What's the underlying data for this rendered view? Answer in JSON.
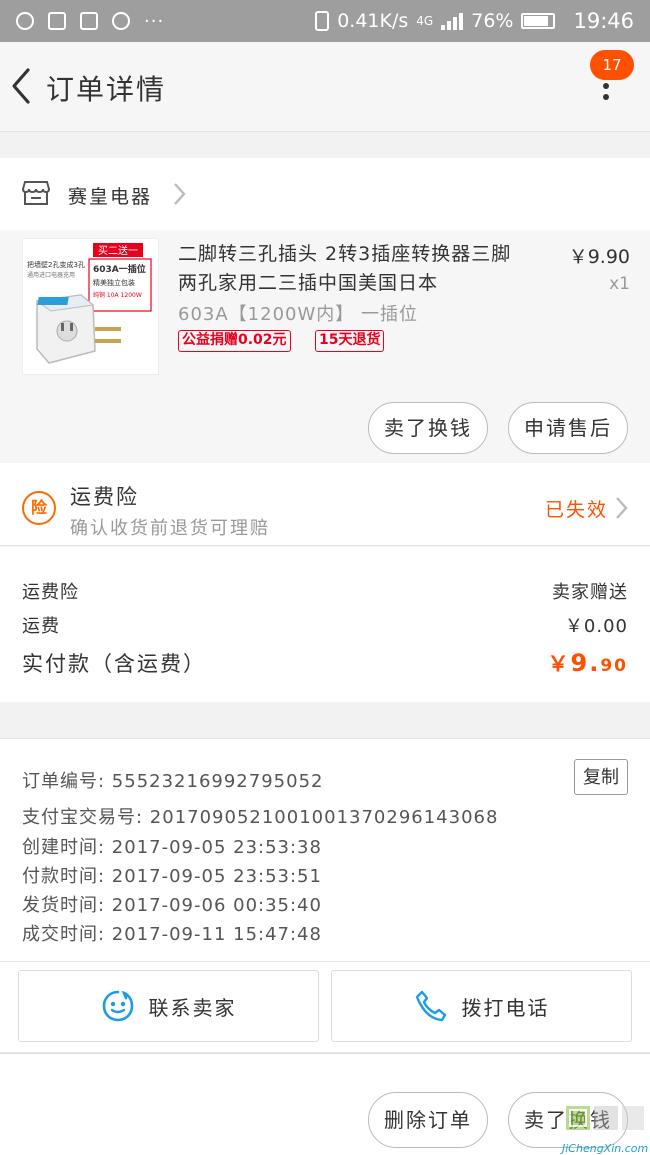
{
  "status_bar": {
    "network_speed": "0.41K/s",
    "network_type": "4G",
    "battery": "76%",
    "time": "19:46",
    "more_glyph": "···"
  },
  "header": {
    "title": "订单详情",
    "badge_count": "17"
  },
  "shop": {
    "name": "赛皇电器"
  },
  "product": {
    "name": "二脚转三孔插头 2转3插座转换器三脚两孔家用二三插中国美国日本",
    "sku": "603A【1200W内】 一插位",
    "tags": [
      "公益捐赠0.02元",
      "15天退货"
    ],
    "price": "￥9.90",
    "quantity": "x1",
    "thumb_text": {
      "banner": "买二送一",
      "line1": "把墙壁2孔变成3孔",
      "line2": "通用进口电器充用",
      "model": "603A一插位",
      "pack": "精美独立包装",
      "spec": "纯铜 10A 1200W"
    },
    "buttons": {
      "sell": "卖了换钱",
      "after_sale": "申请售后"
    }
  },
  "insurance": {
    "icon_char": "险",
    "title": "运费险",
    "subtitle": "确认收货前退货可理赔",
    "status": "已失效"
  },
  "fees": {
    "rows": [
      {
        "label": "运费险",
        "value": "卖家赠送"
      },
      {
        "label": "运费",
        "value": "￥0.00"
      }
    ],
    "total_label": "实付款（含运费）",
    "total_currency": "￥",
    "total_int": "9.",
    "total_dec": "90"
  },
  "order_info": {
    "copy_label": "复制",
    "rows": [
      "订单编号: 55523216992795052",
      "支付宝交易号: 2017090521001001370296143068",
      "创建时间: 2017-09-05 23:53:38",
      "付款时间: 2017-09-05 23:53:51",
      "发货时间: 2017-09-06 00:35:40",
      "成交时间: 2017-09-11 15:47:48"
    ]
  },
  "contact": {
    "seller": "联系卖家",
    "call": "拨打电话"
  },
  "bottom": {
    "delete": "删除订单",
    "sell": "卖了换钱"
  },
  "watermark": {
    "text": "JiChengXin.com"
  },
  "colors": {
    "accent": "#ff5000",
    "tag_red": "#e8001c",
    "icon_blue": "#1e9be8"
  }
}
